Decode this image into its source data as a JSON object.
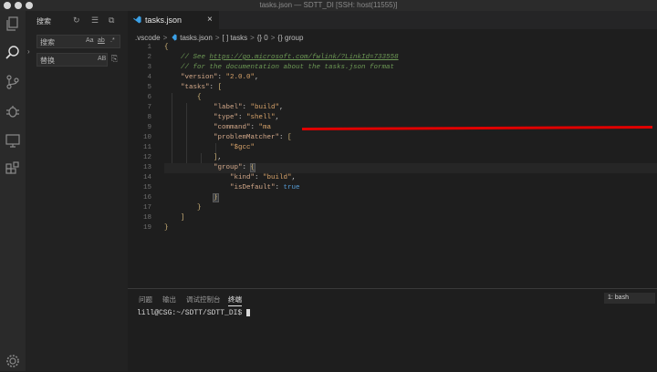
{
  "window": {
    "title": "tasks.json — SDTT_DI [SSH: host(11555)]"
  },
  "sidebar": {
    "title": "搜索",
    "search": {
      "label": "搜索",
      "opts": [
        "Aa",
        "ab",
        ".*"
      ]
    },
    "replace": {
      "label": "替换",
      "opts": [
        "AB"
      ]
    }
  },
  "editor": {
    "tab": {
      "label": "tasks.json",
      "close": "×"
    },
    "breadcrumbs": [
      ".vscode",
      "tasks.json",
      "[ ] tasks",
      "{} 0",
      "{} group"
    ],
    "breadcrumb_sep": ">",
    "lines": [
      {
        "n": "1",
        "code": "{"
      },
      {
        "n": "2",
        "code": "    // See https://go.microsoft.com/fwlink/?LinkId=733558"
      },
      {
        "n": "3",
        "code": "    // for the documentation about the tasks.json format"
      },
      {
        "n": "4",
        "code": "    \"version\": \"2.0.0\","
      },
      {
        "n": "5",
        "code": "    \"tasks\": ["
      },
      {
        "n": "6",
        "code": "        {"
      },
      {
        "n": "7",
        "code": "            \"label\": \"build\","
      },
      {
        "n": "8",
        "code": "            \"type\": \"shell\","
      },
      {
        "n": "9",
        "code": "            \"command\": \"ma"
      },
      {
        "n": "10",
        "code": "            \"problemMatcher\": ["
      },
      {
        "n": "11",
        "code": "                \"$gcc\""
      },
      {
        "n": "12",
        "code": "            ],"
      },
      {
        "n": "13",
        "code": "            \"group\": {"
      },
      {
        "n": "14",
        "code": "                \"kind\": \"build\","
      },
      {
        "n": "15",
        "code": "                \"isDefault\": true"
      },
      {
        "n": "16",
        "code": "            }"
      },
      {
        "n": "17",
        "code": "        }"
      },
      {
        "n": "18",
        "code": "    ]"
      },
      {
        "n": "19",
        "code": "}"
      }
    ]
  },
  "panel": {
    "tabs": [
      "问题",
      "输出",
      "调试控制台",
      "终端"
    ],
    "active_tab": 3,
    "terminal_select": "1: bash",
    "prompt": "lill@CSG:~/SDTT/SDTT_DI$"
  },
  "colors": {
    "accent": "#3ba0e6",
    "redaction": "#e00000"
  },
  "icons": [
    "explorer-icon",
    "search-icon",
    "source-control-icon",
    "debug-icon",
    "remote-explorer-icon",
    "extensions-icon",
    "settings-gear-icon"
  ]
}
